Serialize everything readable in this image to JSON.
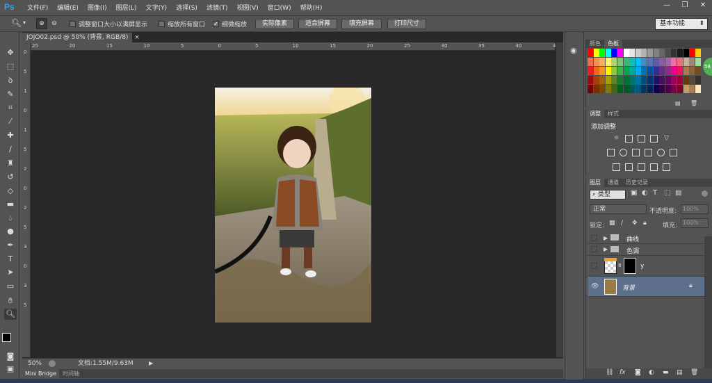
{
  "app": {
    "logo": "Ps"
  },
  "menu": [
    "文件(F)",
    "编辑(E)",
    "图像(I)",
    "图层(L)",
    "文字(Y)",
    "选择(S)",
    "滤镜(T)",
    "视图(V)",
    "窗口(W)",
    "帮助(H)"
  ],
  "window_controls": {
    "minimize": "—",
    "restore": "❐",
    "close": "✕"
  },
  "options": {
    "resize_windows": "调整窗口大小以满屏显示",
    "zoom_all": "缩放所有窗口",
    "scrubby_zoom": "细微缩放",
    "actual_pixels": "实际像素",
    "fit_screen": "适合屏幕",
    "fill_screen": "填充屏幕",
    "print_size": "打印尺寸",
    "workspace": "基本功能"
  },
  "document": {
    "tab_title": "JOJO02.psd @ 50% (背景, RGB/8)",
    "close": "×",
    "zoom": "50%",
    "doc_size": "文档:1.55M/9.63M"
  },
  "ruler_h": [
    "25",
    "20",
    "15",
    "10",
    "5",
    "0",
    "5",
    "10",
    "15",
    "20",
    "25",
    "30",
    "35",
    "40",
    "45"
  ],
  "ruler_v": [
    "0",
    "5",
    "1",
    "0",
    "1",
    "5",
    "2",
    "0",
    "2",
    "5",
    "3",
    "0",
    "3",
    "5"
  ],
  "bottom_tabs": {
    "mini_bridge": "Mini Bridge",
    "timeline": "时间轴"
  },
  "color_panel": {
    "tab_color": "颜色",
    "tab_swatches": "色板"
  },
  "adjust_panel": {
    "tab_adjust": "调整",
    "tab_styles": "样式",
    "heading": "添加调整"
  },
  "layers_panel": {
    "tab_layers": "图层",
    "tab_channels": "通道",
    "tab_history": "历史记录",
    "kind": "类型",
    "blend": "正常",
    "opacity_label": "不透明度:",
    "opacity": "100%",
    "lock_label": "锁定:",
    "fill_label": "填充:",
    "fill": "100%",
    "layers": [
      {
        "name": "曲线",
        "type": "group"
      },
      {
        "name": "色调",
        "type": "group"
      },
      {
        "name": "y",
        "type": "adjustment"
      },
      {
        "name": "背景",
        "type": "background"
      }
    ]
  },
  "colors": {
    "accent": "#2fa3e6",
    "selected_layer": "#5d6f8a",
    "bg": "#535353",
    "canvas": "#282828"
  }
}
